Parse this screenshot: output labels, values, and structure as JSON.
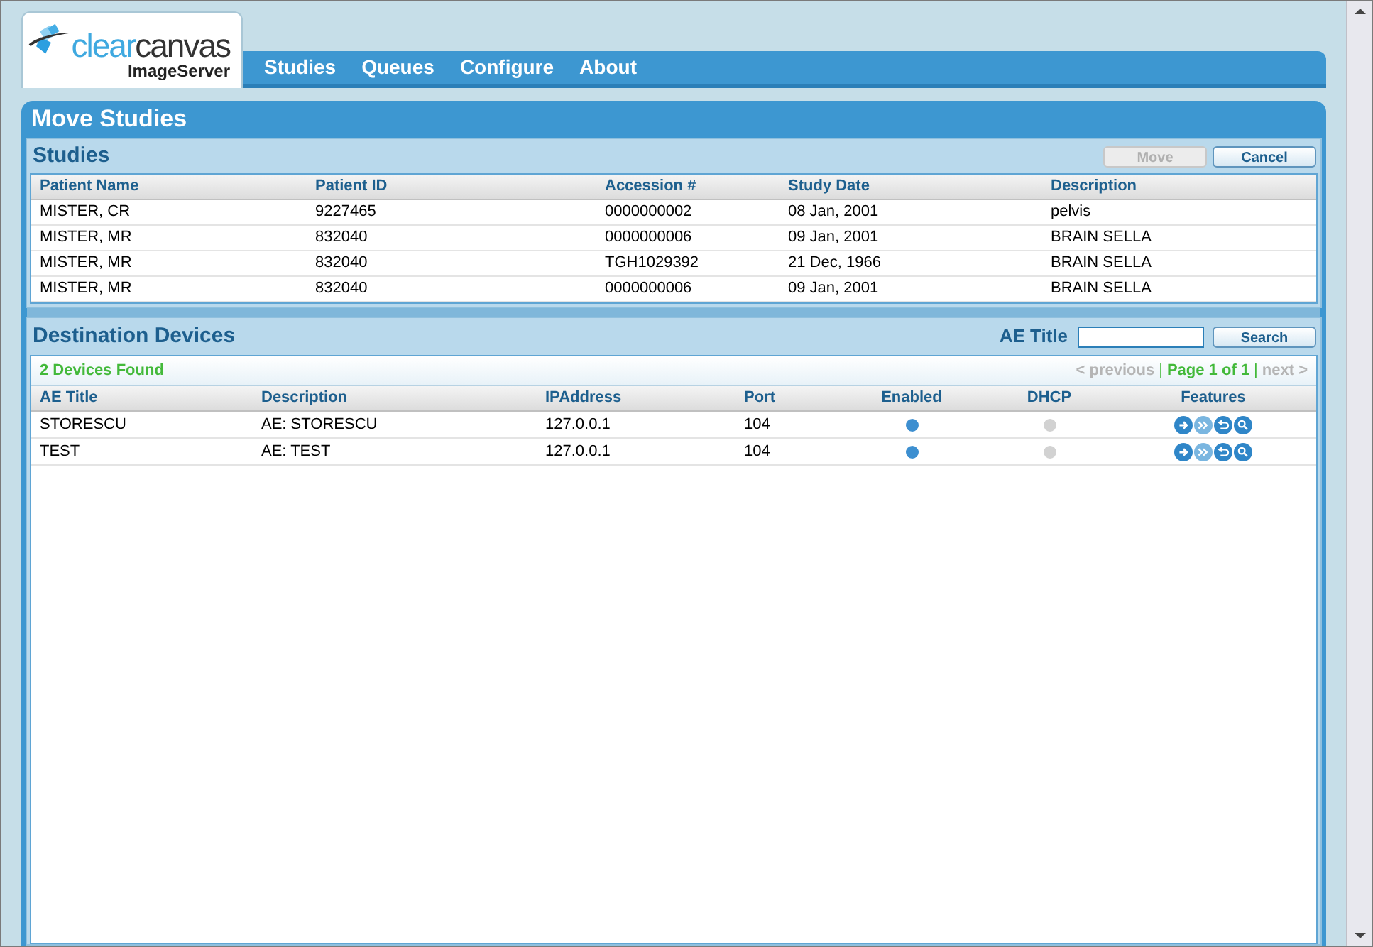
{
  "logo": {
    "brand_light": "clear",
    "brand_dark": "canvas",
    "product": "ImageServer"
  },
  "nav": [
    "Studies",
    "Queues",
    "Configure",
    "About"
  ],
  "panel": {
    "title": "Move Studies"
  },
  "studies": {
    "title": "Studies",
    "buttons": [
      {
        "label": "Move",
        "disabled": true
      },
      {
        "label": "Cancel",
        "disabled": false
      }
    ],
    "columns": [
      "Patient Name",
      "Patient ID",
      "Accession #",
      "Study Date",
      "Description"
    ],
    "rows": [
      [
        "MISTER, CR",
        "9227465",
        "0000000002",
        "08 Jan, 2001",
        "pelvis"
      ],
      [
        "MISTER, MR",
        "832040",
        "0000000006",
        "09 Jan, 2001",
        "BRAIN SELLA"
      ],
      [
        "MISTER, MR",
        "832040",
        "TGH1029392",
        "21 Dec, 1966",
        "BRAIN SELLA"
      ],
      [
        "MISTER, MR",
        "832040",
        "0000000006",
        "09 Jan, 2001",
        "BRAIN SELLA"
      ]
    ]
  },
  "devices": {
    "title": "Destination Devices",
    "search": {
      "label": "AE Title",
      "button": "Search"
    },
    "found": "2 Devices Found",
    "pager": {
      "previous": "< previous",
      "separator_1": "|",
      "page": "Page 1 of 1",
      "separator_2": "|",
      "next": "next >",
      "previous_disabled": true,
      "next_disabled": true
    },
    "columns": [
      "AE Title",
      "Description",
      "IPAddress",
      "Port",
      "Enabled",
      "DHCP",
      "Features"
    ],
    "rows": [
      {
        "ae_title": "STORESCU",
        "description": "AE: STORESCU",
        "ip": "127.0.0.1",
        "port": "104",
        "enabled": true,
        "dhcp": false
      },
      {
        "ae_title": "TEST",
        "description": "AE: TEST",
        "ip": "127.0.0.1",
        "port": "104",
        "enabled": true,
        "dhcp": false
      }
    ]
  }
}
